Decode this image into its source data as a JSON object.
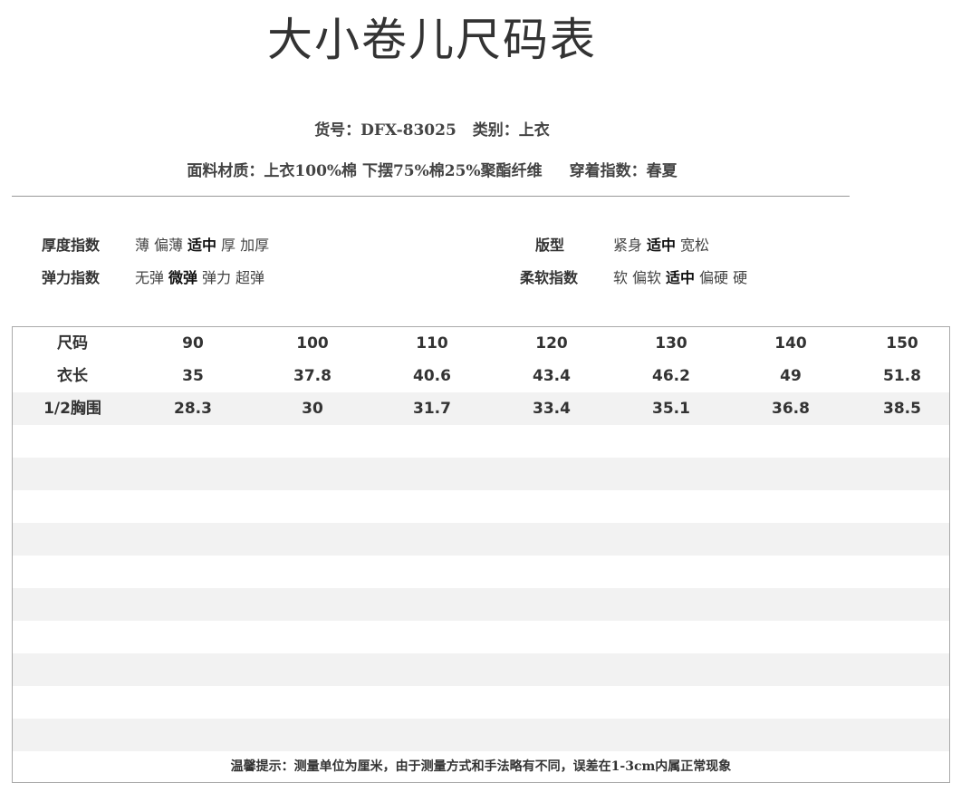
{
  "title": "大小卷儿尺码表",
  "info": {
    "item_no": "货号：DFX-83025",
    "category": "类别：上衣",
    "fabric": "面料材质：上衣100%棉 下摆75%棉25%聚酯纤维",
    "season": "穿着指数：春夏"
  },
  "attributes": {
    "thickness": {
      "label": "厚度指数",
      "options": [
        "薄",
        "偏薄",
        "适中",
        "厚",
        "加厚"
      ],
      "selected": 2
    },
    "fit": {
      "label": "版型",
      "options": [
        "紧身",
        "适中",
        "宽松"
      ],
      "selected": 1
    },
    "elasticity": {
      "label": "弹力指数",
      "options": [
        "无弹",
        "微弹",
        "弹力",
        "超弹"
      ],
      "selected": 1
    },
    "softness": {
      "label": "柔软指数",
      "options": [
        "软",
        "偏软",
        "适中",
        "偏硬",
        "硬"
      ],
      "selected": 2
    }
  },
  "size_table": {
    "rows": [
      [
        "尺码",
        "90",
        "100",
        "110",
        "120",
        "130",
        "140",
        "150"
      ],
      [
        "衣长",
        "35",
        "37.8",
        "40.6",
        "43.4",
        "46.2",
        "49",
        "51.8"
      ],
      [
        "1/2胸围",
        "28.3",
        "30",
        "31.7",
        "33.4",
        "35.1",
        "36.8",
        "38.5"
      ]
    ]
  },
  "footer_note": "温馨提示：测量单位为厘米，由于测量方式和手法略有不同，误差在1-3cm内属正常现象"
}
